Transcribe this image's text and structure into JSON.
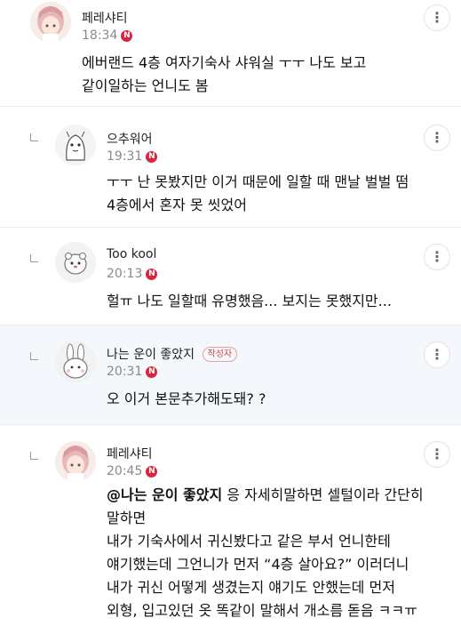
{
  "comments": [
    {
      "author": "페레샤티",
      "time": "18:34",
      "badge": "N",
      "lines": [
        "에버랜드 4층 여자기숙사 샤워실 ㅜㅜ 나도 보고",
        "같이일하는 언니도 봄"
      ],
      "avatar_icon": "anime-girl-avatar"
    },
    {
      "author": "으추워어",
      "time": "19:31",
      "badge": "N",
      "lines": [
        "ㅜㅜ 난 못봤지만 이거 때문에 일할 때 맨날 벌벌 떰",
        "4층에서 혼자 못 씻었어"
      ],
      "avatar_icon": "ghost-character-avatar"
    },
    {
      "author": "Too kool",
      "time": "20:13",
      "badge": "N",
      "lines": [
        "헐ㅠ 나도 일할때 유명했음... 보지는 못했지만..."
      ],
      "avatar_icon": "hamster-avatar"
    },
    {
      "author": "나는 운이 좋았지",
      "author_tag": "작성자",
      "time": "20:31",
      "badge": "N",
      "lines": [
        "오 이거 본문추가해도돼? ?"
      ],
      "avatar_icon": "rabbit-avatar"
    },
    {
      "author": "페레샤티",
      "time": "20:45",
      "badge": "N",
      "mention": "@나는 운이 좋았지",
      "first_line_rest": " 응 자세히말하면 셀털이라 간단히",
      "lines": [
        "말하면",
        "내가 기숙사에서 귀신봤다고 같은 부서 언니한테",
        "얘기했는데 그언니가 먼저 “4층 살아요?” 이러더니",
        "내가 귀신 어떻게 생겼는지 얘기도 안했는데 먼저",
        "외형, 입고있던 옷 똑같이 말해서 개소름 돋음 ㅋㅋㅠ"
      ],
      "avatar_icon": "anime-girl-avatar"
    }
  ],
  "more_icon": "vertical-ellipsis-icon",
  "more_glyph": "⋮",
  "reply_icon": "reply-corner-icon"
}
